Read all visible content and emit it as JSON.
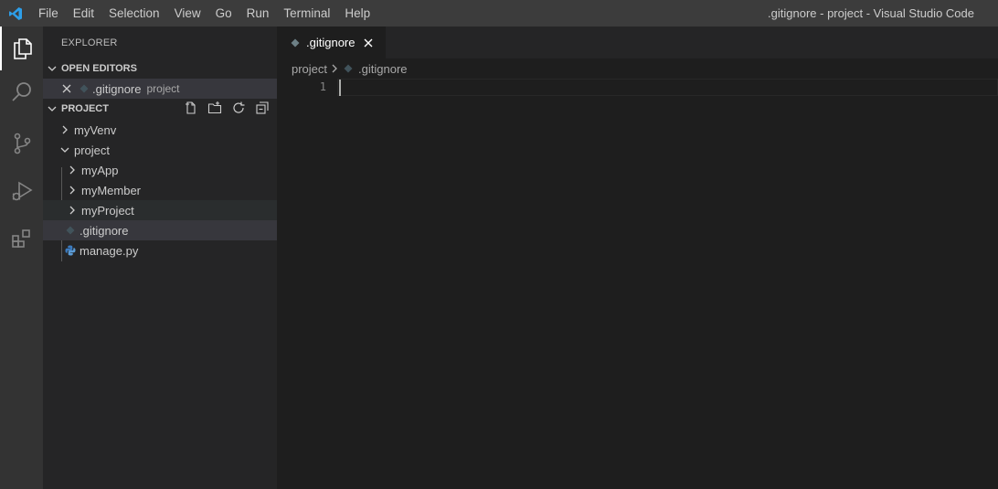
{
  "menu": [
    "File",
    "Edit",
    "Selection",
    "View",
    "Go",
    "Run",
    "Terminal",
    "Help"
  ],
  "window_title": ".gitignore - project - Visual Studio Code",
  "sidebar": {
    "title": "EXPLORER",
    "open_editors": {
      "header": "OPEN EDITORS",
      "items": [
        {
          "name": ".gitignore",
          "description": "project"
        }
      ]
    },
    "project": {
      "header": "PROJECT",
      "tree": [
        {
          "label": "myVenv",
          "type": "folder",
          "expanded": false
        },
        {
          "label": "project",
          "type": "folder",
          "expanded": true
        },
        {
          "label": "myApp",
          "type": "folder",
          "expanded": false
        },
        {
          "label": "myMember",
          "type": "folder",
          "expanded": false
        },
        {
          "label": "myProject",
          "type": "folder",
          "expanded": false
        },
        {
          "label": ".gitignore",
          "type": "file",
          "selected": true
        },
        {
          "label": "manage.py",
          "type": "python-file"
        }
      ]
    }
  },
  "editor": {
    "tab": ".gitignore",
    "breadcrumbs": [
      "project",
      ".gitignore"
    ],
    "line_numbers": [
      "1"
    ]
  },
  "colors": {
    "titlebar": "#3c3c3c",
    "activitybar": "#333333",
    "sidebar": "#252526",
    "editor": "#1e1e1e",
    "selection": "#37373d",
    "vscode_blue": "#2d9ee8"
  }
}
